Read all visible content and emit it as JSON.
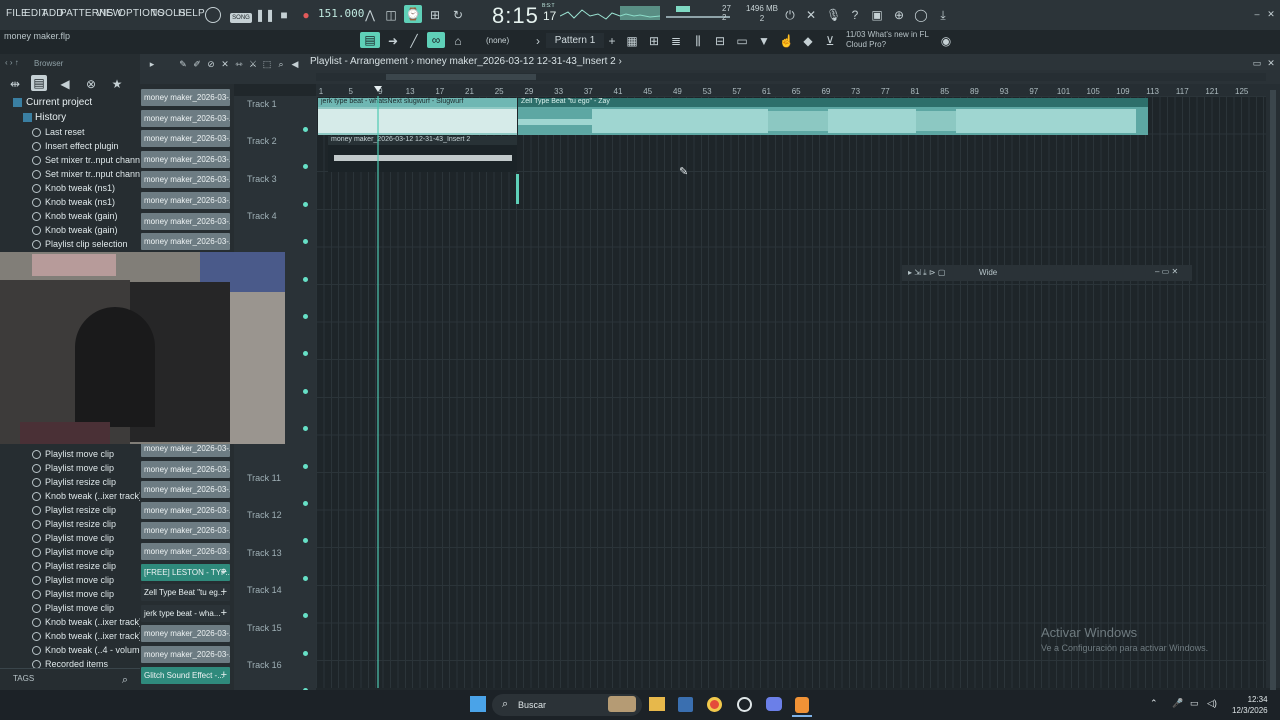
{
  "menu": [
    "FILE",
    "EDIT",
    "ADD",
    "PATTERNS",
    "VIEW",
    "OPTIONS",
    "TOOLS",
    "HELP"
  ],
  "project_file": "money maker.flp",
  "transport": {
    "song_mode_label": "SONG",
    "tempo": "151.000",
    "clock": "8:15",
    "clock_ticks": "17",
    "clock_unit": "B:S:T"
  },
  "status": {
    "cpu": "27",
    "cpu2": "2",
    "memory": "1496 MB",
    "memory2": "2"
  },
  "news": {
    "date": "11/03",
    "line1": "What's new in FL",
    "line2": "Cloud Pro?"
  },
  "toolbar2": {
    "none_label": "(none)",
    "pattern_label": "Pattern 1"
  },
  "browser": {
    "header": "Browser",
    "current_project": "Current project",
    "history": "History",
    "items_top": [
      "Last reset",
      "Insert effect plugin",
      "Set mixer tr..nput channel",
      "Set mixer tr..nput channel",
      "Knob tweak (ns1)",
      "Knob tweak (ns1)",
      "Knob tweak (gain)",
      "Knob tweak (gain)",
      "Playlist clip selection"
    ],
    "items_bottom": [
      "Playlist move clip",
      "Playlist move clip",
      "Playlist resize clip",
      "Knob tweak (..ixer track)",
      "Playlist resize clip",
      "Playlist resize clip",
      "Playlist move clip",
      "Playlist move clip",
      "Playlist resize clip",
      "Playlist move clip",
      "Playlist move clip",
      "Playlist move clip",
      "Knob tweak (..ixer track)",
      "Knob tweak (..ixer track)",
      "Knob tweak (..4 - volume)",
      "Recorded items"
    ],
    "tags_label": "TAGS"
  },
  "picker": {
    "top": [
      "money maker_2026-03-...",
      "money maker_2026-03-...",
      "money maker_2026-03-...",
      "money maker_2026-03-...",
      "money maker_2026-03-...",
      "money maker_2026-03-...",
      "money maker_2026-03-...",
      "money maker_2026-03-..."
    ],
    "bottom": [
      "money maker_2026-03-...",
      "money maker_2026-03-...",
      "money maker_2026-03-...",
      "money maker_2026-03-...",
      "money maker_2026-03-...",
      "money maker_2026-03-...",
      "[FREE] LESTON - TYP...",
      "Zell Type Beat \"tu eg...",
      "jerk type beat - wha...",
      "money maker_2026-03-...",
      "money maker_2026-03-...",
      "Glitch Sound Effect -..."
    ]
  },
  "playlist": {
    "title": "Playlist - Arrangement",
    "breadcrumb": "money maker_2026-03-12 12-31-43_Insert 2",
    "bar_numbers": [
      "1",
      "5",
      "9",
      "13",
      "17",
      "21",
      "25",
      "29",
      "33",
      "37",
      "41",
      "45",
      "49",
      "53",
      "57",
      "61",
      "65",
      "69",
      "73",
      "77",
      "81",
      "85",
      "89",
      "93",
      "97",
      "101",
      "105",
      "109",
      "113",
      "117",
      "121",
      "125"
    ],
    "tracks": [
      "Track 1",
      "Track 2",
      "Track 3",
      "Track 4",
      "Track 11",
      "Track 12",
      "Track 13",
      "Track 14",
      "Track 15",
      "Track 16"
    ],
    "clips": {
      "c1": "jerk type beat - whatsNext slugwurf - Slugwurf",
      "c2": "Zell Type Beat \"tu ego\" - Zay",
      "c3": "money maker_2026-03-12 12-31-43_Insert 2"
    }
  },
  "float_window": {
    "title": "Wide"
  },
  "watermark": {
    "line1": "Activar Windows",
    "line2": "Ve a Configuración para activar Windows."
  },
  "taskbar": {
    "search": "Buscar",
    "time": "12:34",
    "date": "12/3/2026"
  },
  "colors": {
    "accent": "#5fd0b8",
    "clip_teal": "#6fb7b3",
    "clip_bg": "#8fc9c4"
  }
}
